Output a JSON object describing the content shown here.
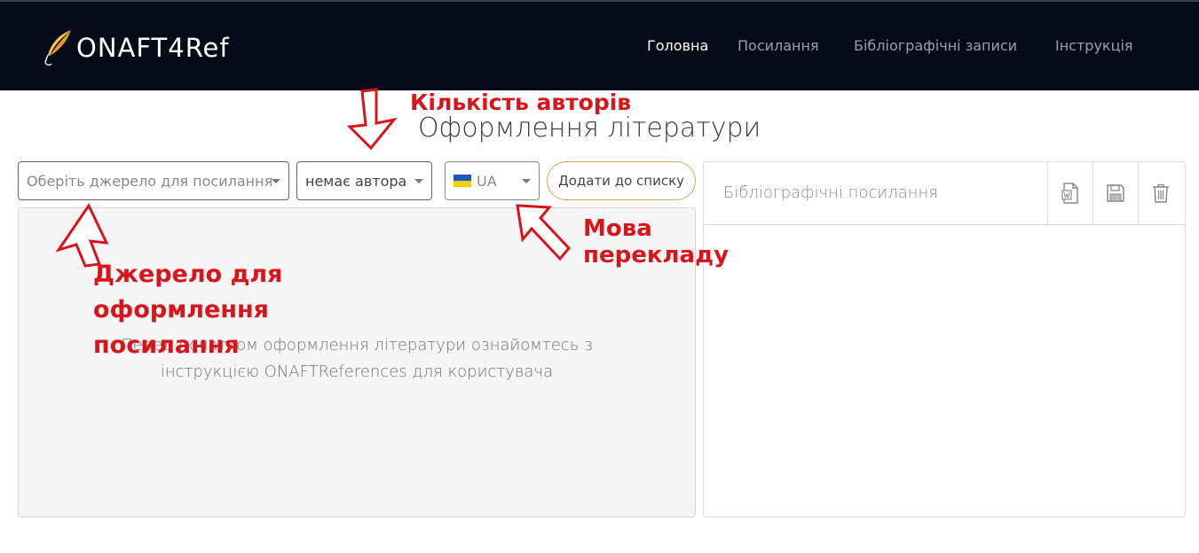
{
  "brand": {
    "name": "ONAFT4Ref"
  },
  "nav": {
    "items": [
      {
        "label": "Головна"
      },
      {
        "label": "Посилання"
      },
      {
        "label": "Бібліографічні записи"
      },
      {
        "label": "Інструкція"
      }
    ]
  },
  "page": {
    "title": "Оформлення літератури"
  },
  "controls": {
    "source_placeholder": "Оберіть джерело для посилання",
    "authors_value": "немає автора",
    "language_value": "UA",
    "add_button": "Додати до списку"
  },
  "left_panel": {
    "hint_line1": "Перед початком оформлення літератури ознайомтесь з",
    "hint_line2": "інструкцією ONAFTReferences для користувача"
  },
  "right_panel": {
    "title": "Бібліографічні посилання",
    "icons": [
      "word-export-icon",
      "save-icon",
      "trash-icon"
    ]
  },
  "annotations": {
    "authors_count": "Кількість авторів",
    "translation_lang_line1": "Мова",
    "translation_lang_line2": "перекладу",
    "source_line1": "Джерело для",
    "source_line2": "оформлення",
    "source_line3": "посилання"
  },
  "colors": {
    "navbar_bg": "#070b17",
    "annotation_red": "#d7151b",
    "add_button_border": "#d9a25f",
    "flag_blue": "#1a56c4",
    "flag_yellow": "#f5d000"
  }
}
